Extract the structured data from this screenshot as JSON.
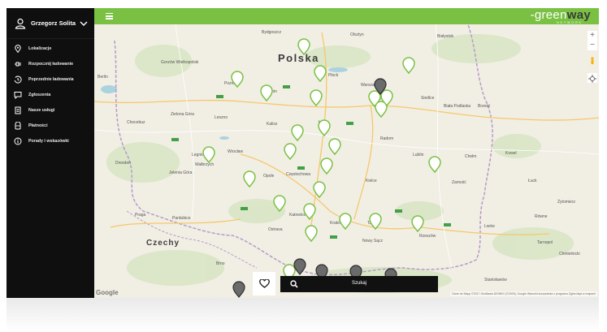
{
  "user": {
    "name": "Grzegorz Solita"
  },
  "menu": [
    {
      "label": "Lokalizacje",
      "icon": "map-pin-icon"
    },
    {
      "label": "Rozpocznij ładowanie",
      "icon": "plug-icon"
    },
    {
      "label": "Poprzednie ładowania",
      "icon": "history-icon"
    },
    {
      "label": "Zgłoszenia",
      "icon": "chat-icon"
    },
    {
      "label": "Nasze usługi",
      "icon": "document-icon"
    },
    {
      "label": "Płatności",
      "icon": "wallet-icon"
    },
    {
      "label": "Porady i wskazówki",
      "icon": "info-icon"
    }
  ],
  "brand": {
    "logo_main": "-green",
    "logo_accent": "way",
    "logo_sub": "NETWORK",
    "accent_color": "#7ac143",
    "dark_color": "#111111"
  },
  "map": {
    "country_label": "Polska",
    "neighbor_label": "Czechy",
    "provider": "Google",
    "attribution": "Dane do Mapy ©2017 GeoBasis-DE/BKG (©2009), Google  Warunki korzystania z programu  Zgłoś błąd w mapach",
    "cities": [
      "Bydgoszcz",
      "Olsztyn",
      "Białystok",
      "Berlin",
      "Gorzów Wielkopolski",
      "Poznań",
      "Płock",
      "Konin",
      "Warszawa",
      "Siedlce",
      "Biała Podlaska",
      "Brześć",
      "Zielona Góra",
      "Leszno",
      "Kalisz",
      "Łódź",
      "Chocebuz",
      "Legnica",
      "Wrocław",
      "Opole",
      "Częstochowa",
      "Kielce",
      "Radom",
      "Lublin",
      "Chełm",
      "Zamość",
      "Łuck",
      "Tarnów",
      "Kraków",
      "Katowice",
      "Praga",
      "Pardubice",
      "Ostrava",
      "Rzeszów",
      "Nowy Sącz",
      "Brno",
      "Lwów",
      "Tarnopol",
      "Stanisławów",
      "Dresden",
      "Wałbrzych",
      "Jelenia Góra",
      "Żytomierz",
      "Kowel",
      "Równe",
      "Chmielnicki"
    ]
  },
  "search": {
    "label": "Szukaj"
  }
}
